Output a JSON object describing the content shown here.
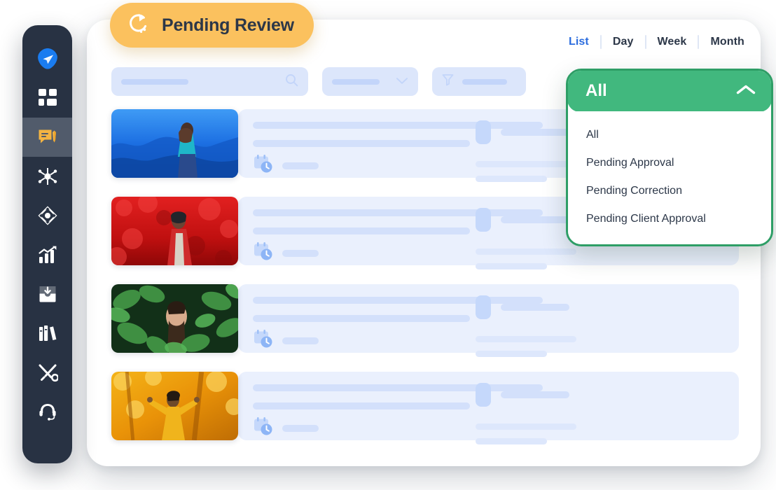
{
  "badge": {
    "label": "Pending Review",
    "icon": "refresh-spinner-icon",
    "color": "#fbc15e"
  },
  "sidebar": {
    "background": "#283243",
    "items": [
      {
        "name": "send-icon",
        "active": false
      },
      {
        "name": "dashboard-grid-icon",
        "active": false
      },
      {
        "name": "chat-edit-icon",
        "active": true
      },
      {
        "name": "network-share-icon",
        "active": false
      },
      {
        "name": "compass-diamond-icon",
        "active": false
      },
      {
        "name": "analytics-chart-icon",
        "active": false
      },
      {
        "name": "inbox-download-icon",
        "active": false
      },
      {
        "name": "library-books-icon",
        "active": false
      },
      {
        "name": "tools-icon",
        "active": false
      },
      {
        "name": "support-headset-icon",
        "active": false
      }
    ]
  },
  "tabs": {
    "items": [
      {
        "label": "List",
        "active": true
      },
      {
        "label": "Day",
        "active": false
      },
      {
        "label": "Week",
        "active": false
      },
      {
        "label": "Month",
        "active": false
      }
    ],
    "active_color": "#2b6cde",
    "inactive_color": "#2c3748"
  },
  "filters": {
    "search": {
      "placeholder": "",
      "value": "",
      "icon": "search-icon"
    },
    "select": {
      "value": "",
      "icon": "chevron-down-icon"
    },
    "filter": {
      "value": "",
      "icon": "funnel-icon"
    }
  },
  "dropdown": {
    "selected": "All",
    "chevron": "chevron-up-icon",
    "accent": "#41b87e",
    "border": "#2e9e66",
    "options": [
      "All",
      "Pending Approval",
      "Pending Correction",
      "Pending Client Approval"
    ]
  },
  "list": {
    "rows": [
      {
        "thumb": "photo-woman-blue-mountain",
        "palette": [
          "#1f6fe0",
          "#2f8ef0",
          "#0d4aa8"
        ]
      },
      {
        "thumb": "photo-woman-red-foliage",
        "palette": [
          "#cf1414",
          "#ef2b2b",
          "#8f0b0b"
        ]
      },
      {
        "thumb": "photo-man-green-leaves",
        "palette": [
          "#2f7a36",
          "#49a84f",
          "#17401c"
        ]
      },
      {
        "thumb": "photo-man-autumn-gold",
        "palette": [
          "#e6a111",
          "#f6c43a",
          "#b87306"
        ]
      }
    ],
    "row_icon": "calendar-clock-icon"
  }
}
